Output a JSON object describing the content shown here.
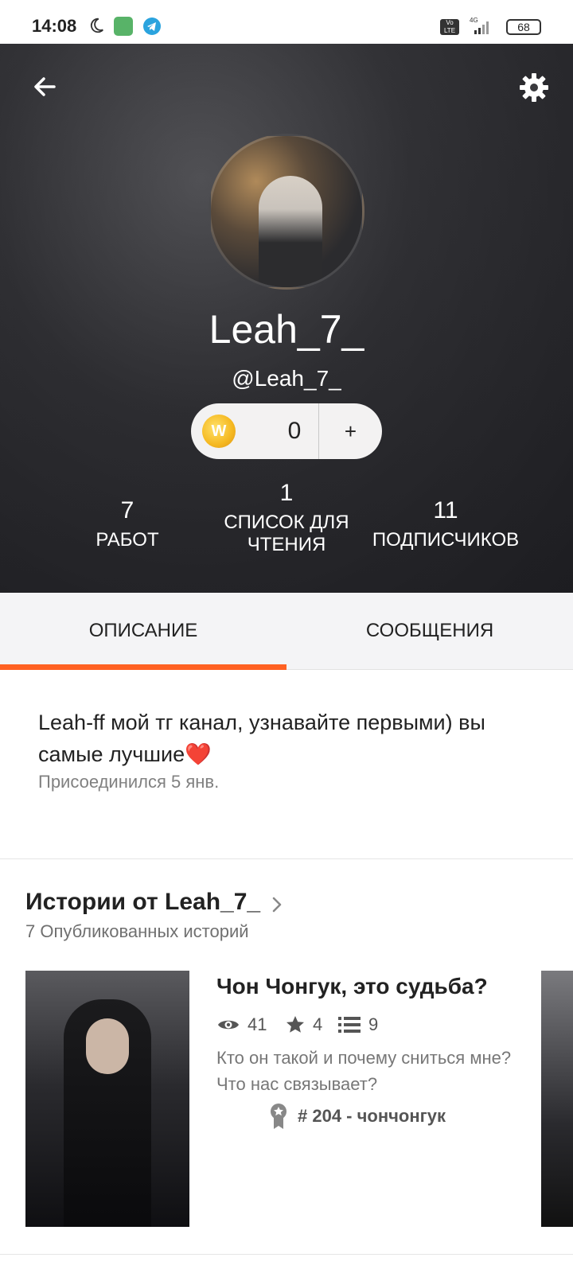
{
  "status_bar": {
    "time": "14:08",
    "battery": "68",
    "network": "4G",
    "volte": "Vo LTE"
  },
  "header": {
    "back_icon": "arrow-left",
    "settings_icon": "gear",
    "display_name": "Leah_7_",
    "handle": "@Leah_7_",
    "coins": {
      "value": "0",
      "plus": "+"
    },
    "stats": [
      {
        "value": "7",
        "label": "РАБОТ"
      },
      {
        "value": "1",
        "label": "СПИСОК ДЛЯ ЧТЕНИЯ"
      },
      {
        "value": "11",
        "label": "ПОДПИСЧИКОВ"
      }
    ]
  },
  "tabs": [
    {
      "label": "ОПИСАНИЕ",
      "active": true
    },
    {
      "label": "СООБЩЕНИЯ",
      "active": false
    }
  ],
  "about": {
    "text": "Leah-ff мой тг канал, узнавайте первыми) вы самые лучшие",
    "emoji": "❤️",
    "joined": "Присоединился 5 янв."
  },
  "stories_section": {
    "title": "Истории от Leah_7_",
    "subtitle": "7 Опубликованных историй",
    "story": {
      "title": "Чон Чонгук, это судьба?",
      "reads": "41",
      "votes": "4",
      "parts": "9",
      "description": "Кто он такой и почему сниться мне? Что нас связывает?",
      "rank": "# 204 - чончонгук"
    }
  },
  "colors": {
    "accent": "#ff6122",
    "heart": "#d7262b"
  }
}
